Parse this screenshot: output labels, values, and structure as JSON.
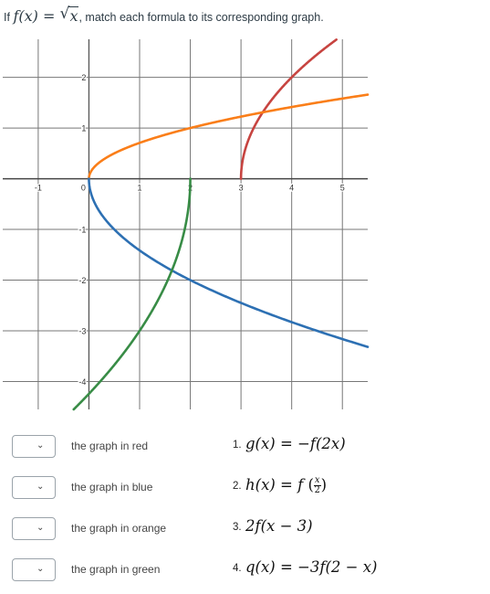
{
  "question": {
    "prefix": "If",
    "function_lhs": "f(x) =",
    "function_radicand": "x",
    "text": ", match each formula to its corresponding graph."
  },
  "chart_data": {
    "type": "line",
    "title": "",
    "xlabel": "",
    "ylabel": "",
    "xlim": [
      -1.7,
      5.5
    ],
    "ylim": [
      -4.55,
      2.75
    ],
    "grid": true,
    "x_ticks": [
      -1,
      0,
      1,
      2,
      3,
      4,
      5
    ],
    "x_tick_labels": [
      "-1",
      "0",
      "1",
      "2",
      "3",
      "4",
      "5"
    ],
    "y_ticks": [
      2,
      1,
      -1,
      -2,
      -3,
      -4
    ],
    "y_tick_labels": [
      "2",
      "1",
      "-1",
      "-2",
      "-3",
      "-4"
    ],
    "series": [
      {
        "name": "red",
        "color": "#c74440",
        "formula": "2*sqrt(x-3)",
        "x": [
          3,
          3.05,
          3.25,
          3.5,
          4,
          4.5,
          5
        ],
        "y": [
          0,
          0.447,
          1.0,
          1.414,
          2.0,
          2.449,
          2.828
        ]
      },
      {
        "name": "orange",
        "color": "#fa7e19",
        "formula": "sqrt(x/2)",
        "x": [
          0,
          0.5,
          1,
          2,
          3,
          4,
          5,
          5.5
        ],
        "y": [
          0,
          0.5,
          0.707,
          1.0,
          1.225,
          1.414,
          1.581,
          1.658
        ]
      },
      {
        "name": "blue",
        "color": "#2d70b3",
        "formula": "-sqrt(2x)",
        "x": [
          0,
          0.125,
          0.5,
          1,
          2,
          3,
          4,
          5,
          5.5
        ],
        "y": [
          0,
          -0.5,
          -1.0,
          -1.414,
          -2.0,
          -2.449,
          -2.828,
          -3.162,
          -3.317
        ]
      },
      {
        "name": "green",
        "color": "#388c46",
        "formula": "-3*sqrt(2-x)",
        "x": [
          -0.3,
          0,
          1,
          1.5,
          1.9,
          2
        ],
        "y": [
          -4.55,
          -4.243,
          -3.0,
          -2.121,
          -0.949,
          0
        ]
      }
    ]
  },
  "matching": {
    "rows": [
      {
        "label": "the graph in red",
        "selected": "",
        "number": "1.",
        "formula_lhs": "g(x) = −f(2x)"
      },
      {
        "label": "the graph in blue",
        "selected": "",
        "number": "2.",
        "formula_lhs": "h(x) = f"
      },
      {
        "label": "the graph in orange",
        "selected": "",
        "number": "3.",
        "formula_lhs": "2f(x − 3)"
      },
      {
        "label": "the graph in green",
        "selected": "",
        "number": "4.",
        "formula_lhs": "q(x) = −3f(2 − x)"
      }
    ],
    "frac_num": "x",
    "frac_den": "2",
    "chevron": "⌄"
  }
}
